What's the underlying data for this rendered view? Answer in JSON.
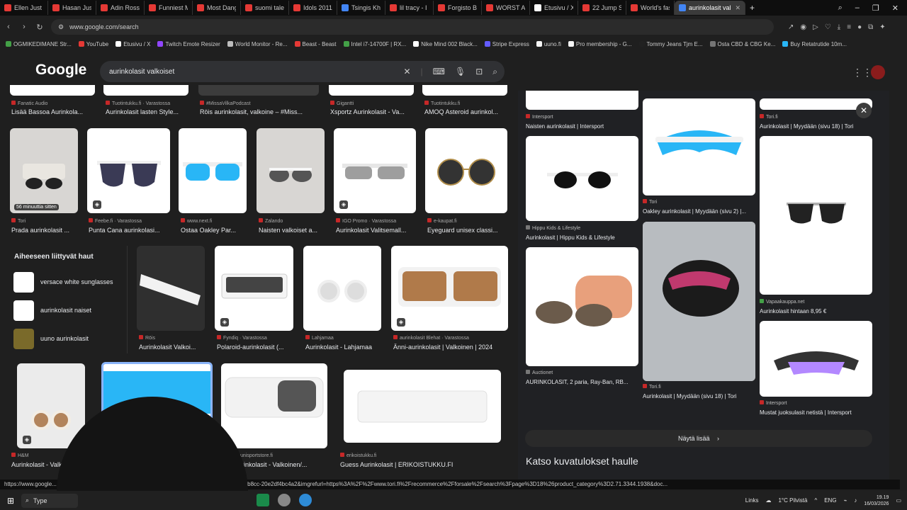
{
  "tabs": [
    {
      "label": "Ellen Just Tie",
      "color": "#e53935"
    },
    {
      "label": "Hasan Just F",
      "color": "#e53935"
    },
    {
      "label": "Adin Ross Re",
      "color": "#e53935"
    },
    {
      "label": "Funniest Mon",
      "color": "#e53935"
    },
    {
      "label": "Most Danger",
      "color": "#e53935"
    },
    {
      "label": "suomi talent",
      "color": "#e53935"
    },
    {
      "label": "Idols 2011: T",
      "color": "#e53935"
    },
    {
      "label": "Tsingis Khan",
      "color": "#4285f4"
    },
    {
      "label": "lil tracy - I can",
      "color": "#e53935"
    },
    {
      "label": "Forgisto Blow",
      "color": "#e53935"
    },
    {
      "label": "WORST Audit",
      "color": "#e53935"
    },
    {
      "label": "Etusivu / X",
      "color": "#ffffff"
    },
    {
      "label": "22 Jump Stre",
      "color": "#e53935"
    },
    {
      "label": "World's faste",
      "color": "#e53935"
    },
    {
      "label": "aurinkolasit valkoiset -",
      "color": "#4285f4",
      "active": true
    }
  ],
  "address": {
    "url": "www.google.com/search"
  },
  "bookmarks": [
    {
      "label": "OGMIKEDIMANE Str...",
      "color": "#43a047"
    },
    {
      "label": "YouTube",
      "color": "#e53935"
    },
    {
      "label": "Etusivu / X",
      "color": "#ffffff"
    },
    {
      "label": "Twitch Emote Resizer",
      "color": "#9146ff"
    },
    {
      "label": "World Monitor - Re...",
      "color": "#bdbdbd"
    },
    {
      "label": "Beast - Beast",
      "color": "#e53935"
    },
    {
      "label": "Intel i7-14700F | RX...",
      "color": "#43a047"
    },
    {
      "label": "Nike Mind 002 Black...",
      "color": "#ffffff"
    },
    {
      "label": "Stripe Express",
      "color": "#635bff"
    },
    {
      "label": "uuno.fi",
      "color": "#f5f5f5"
    },
    {
      "label": "Pro membership - G...",
      "color": "#f5f5f5"
    },
    {
      "label": "Tommy Jeans Tjm E...",
      "color": "#212121"
    },
    {
      "label": "Osta CBD & CBG Ke...",
      "color": "#757575"
    },
    {
      "label": "Buy Retatrutide 10m...",
      "color": "#29b6f6"
    }
  ],
  "google": {
    "logo": "Google",
    "query": "aurinkolasit valkoiset"
  },
  "row0": [
    {
      "src": "Fanatic Audio",
      "title": "Lisää Bassoa Aurinkola..."
    },
    {
      "src": "Tuotintukku.fi · Varastossa",
      "title": "Aurinkolasit lasten Style..."
    },
    {
      "src": "#MissaVilkaPodcast",
      "title": "Röis aurinkolasit, valkoine – #Miss..."
    },
    {
      "src": "Gigantti",
      "title": "Xsportz Aurinkolasit - Va..."
    },
    {
      "src": "Tuotintukku.fi",
      "title": "AMOQ Asteroid aurinkol..."
    }
  ],
  "row1": [
    {
      "src": "Tori",
      "title": "Prada aurinkolasit ...",
      "badge": "56 minuuttia sitten"
    },
    {
      "src": "Feebe.fi · Varastossa",
      "title": "Punta Cana aurinkolasi..."
    },
    {
      "src": "www.next.fi",
      "title": "Ostaa Oakley Par..."
    },
    {
      "src": "Zalando",
      "title": "Naisten valkoiset a..."
    },
    {
      "src": "IGO Promo · Varastossa",
      "title": "Aurinkolasit Valitsemall..."
    },
    {
      "src": "e-kaupat.fi",
      "title": "Eyeguard unisex classi..."
    }
  ],
  "related": {
    "heading": "Aiheeseen liittyvät haut",
    "items": [
      {
        "label": "versace white sunglasses"
      },
      {
        "label": "aurinkolasit naiset"
      },
      {
        "label": "uuno aurinkolasit"
      }
    ]
  },
  "row2": [
    {
      "src": "Röis",
      "title": "Aurinkolasit Valkoi..."
    },
    {
      "src": "Fyndiq · Varastossa",
      "title": "Polaroid-aurinkolasit (..."
    },
    {
      "src": "Lahjamaa",
      "title": "Aurinkolasit - Lahjamaa"
    },
    {
      "src": "aurinkolasit Blehat · Varastossa",
      "title": "Änni-aurinkolasit | Valkoinen | 2024"
    }
  ],
  "row3": [
    {
      "src": "H&M",
      "title": "Aurinkolasit - Valko..."
    },
    {
      "src": "",
      "title": ""
    },
    {
      "src": "unisportstore.fi",
      "title": "Aurinkolasit - Valkoinen/..."
    },
    {
      "src": "erikoistukku.fi",
      "title": "Guess Aurinkolasit | ERIKOISTUKKU.FI"
    }
  ],
  "panel": {
    "col1": [
      {
        "src": "Intersport",
        "title": "Naisten aurinkolasit | Intersport"
      },
      {
        "src": "Hippu Kids & Lifestyle",
        "title": "Aurinkolasit | Hippu Kids & Lifestyle"
      },
      {
        "src": "Auctionet",
        "title": "AURINKOLASIT, 2 paria, Ray-Ban, RB..."
      }
    ],
    "col2": [
      {
        "src": "Tori",
        "title": "Oakley aurinkolasit | Myydään (sivu 2) |..."
      },
      {
        "src": "Tori.fi",
        "title": "Aurinkolasit | Myydään (sivu 18) | Tori"
      }
    ],
    "col3": [
      {
        "src": "Tori.fi",
        "title": "Aurinkolasit | Myydään (sivu 18) | Tori"
      },
      {
        "src": "Vapaakauppa.net",
        "title": "Aurinkolasit hintaan 8,95 €"
      },
      {
        "src": "Intersport",
        "title": "Mustat juoksulasit netistä | Intersport"
      }
    ],
    "more": "Näytä lisää",
    "image_heading": "Katso kuvatulokset haulle"
  },
  "status_url": "https://www.google... ...net%2Fdyniamc%2Fdefault%2Fitem%2F3725004%2F0eca0c4-4ff4-44fe-b8cc-20e2df4bc4a2&imgrefurl=https%3A%2F%2Fwww.tori.fi%2Frecommerce%2Fforsale%2Fsearch%3Fpage%3D18%26product_category%3D2.71.3344.1938&doc...",
  "taskbar": {
    "search": "Type",
    "links": "Links",
    "weather": "1°C  Pilvistä",
    "lang": "ENG",
    "time": "19.19",
    "date": "16/03/2026"
  }
}
